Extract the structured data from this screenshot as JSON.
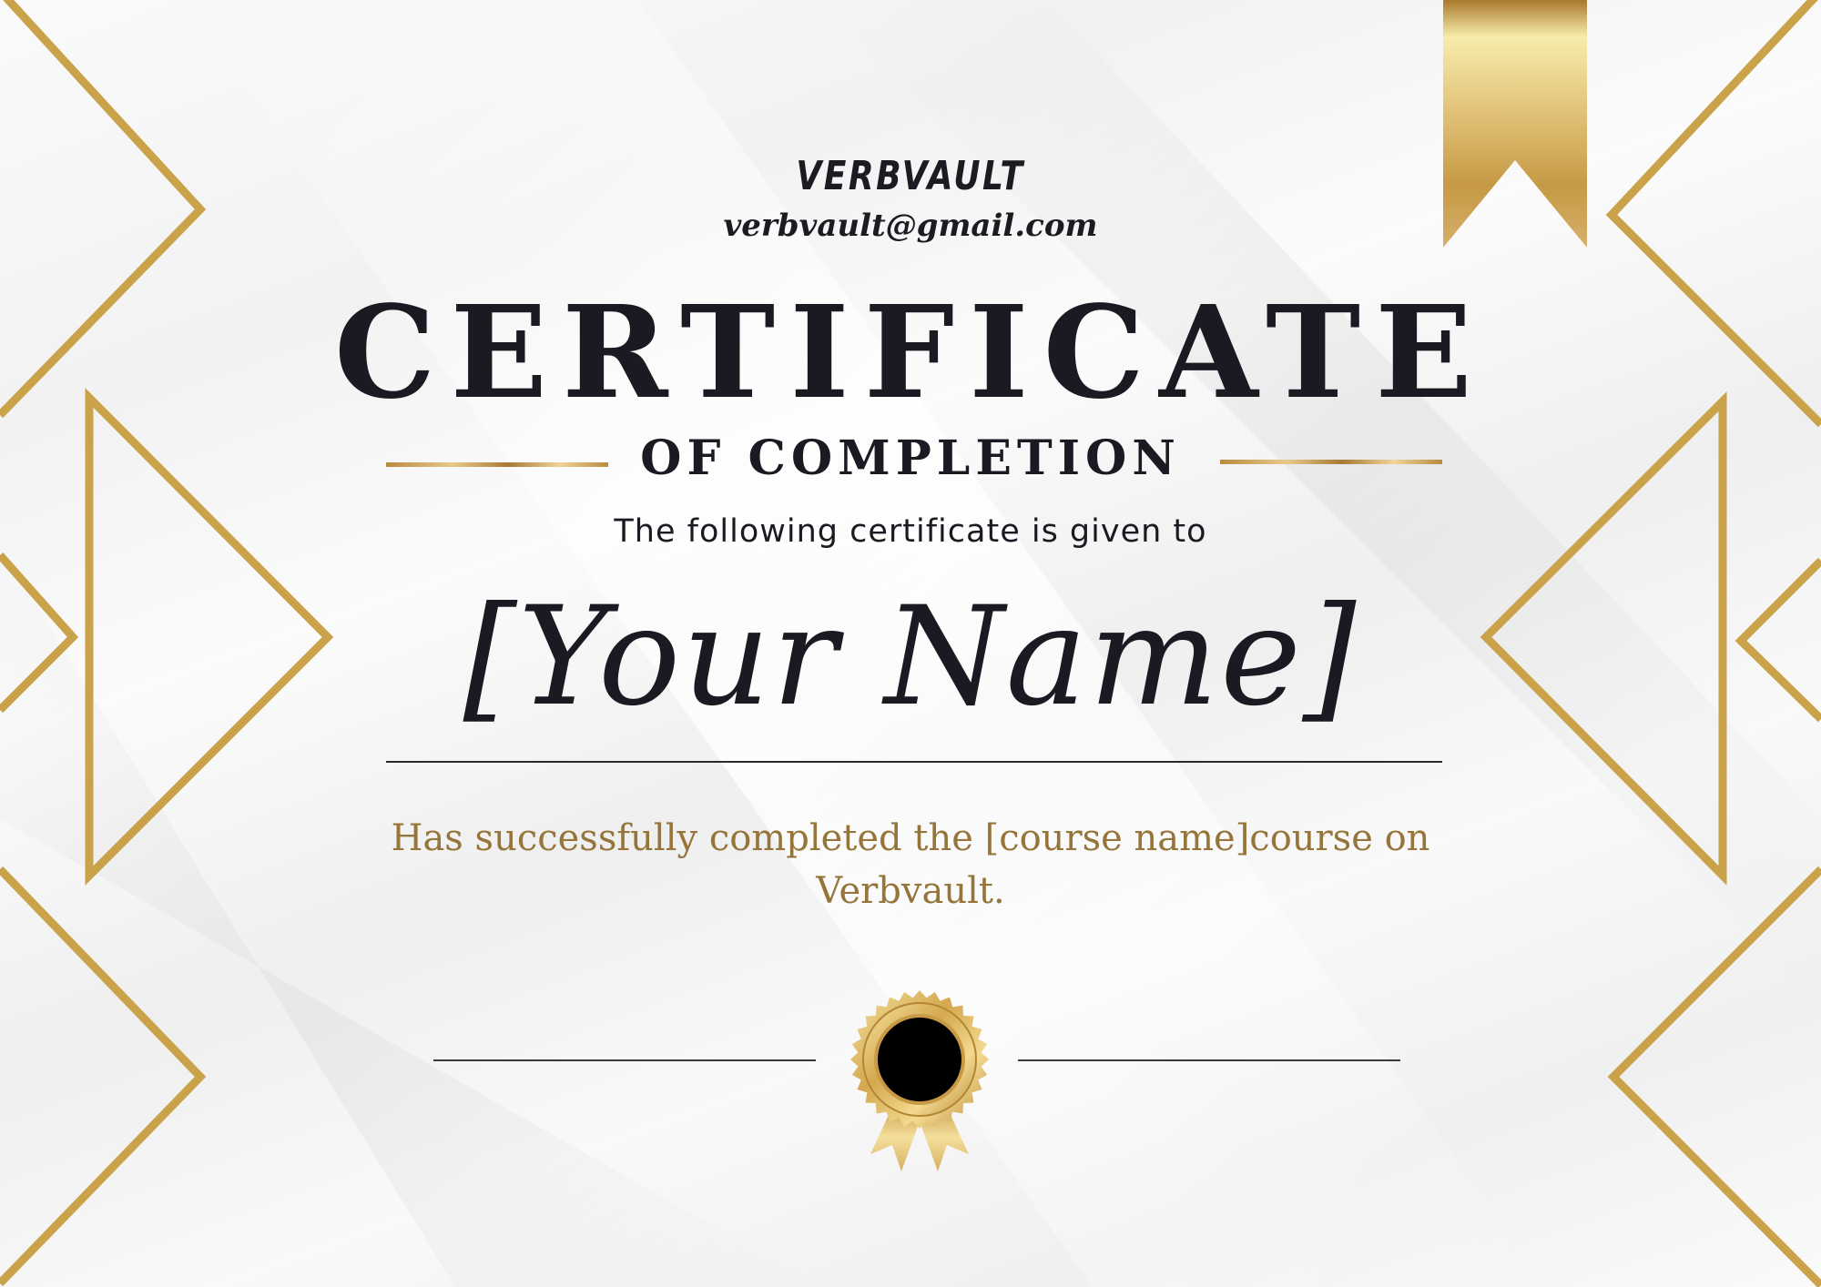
{
  "brand": {
    "name": "VERBVAULT",
    "email": "verbvault@gmail.com"
  },
  "certificate": {
    "title": "CERTIFICATE",
    "subtitle": "OF COMPLETION",
    "intro": "The following certificate is given to",
    "recipient": "[Your Name]",
    "body_line1": "Has successfully completed the [course name]course on",
    "body_line2": "Verbvault."
  },
  "colors": {
    "gold": "#c9a24a",
    "dark": "#1b1a22",
    "body_text": "#96753a",
    "seal_center": "#000000"
  },
  "icons": {
    "ribbon": "bookmark-ribbon-icon",
    "seal": "award-seal-icon"
  }
}
